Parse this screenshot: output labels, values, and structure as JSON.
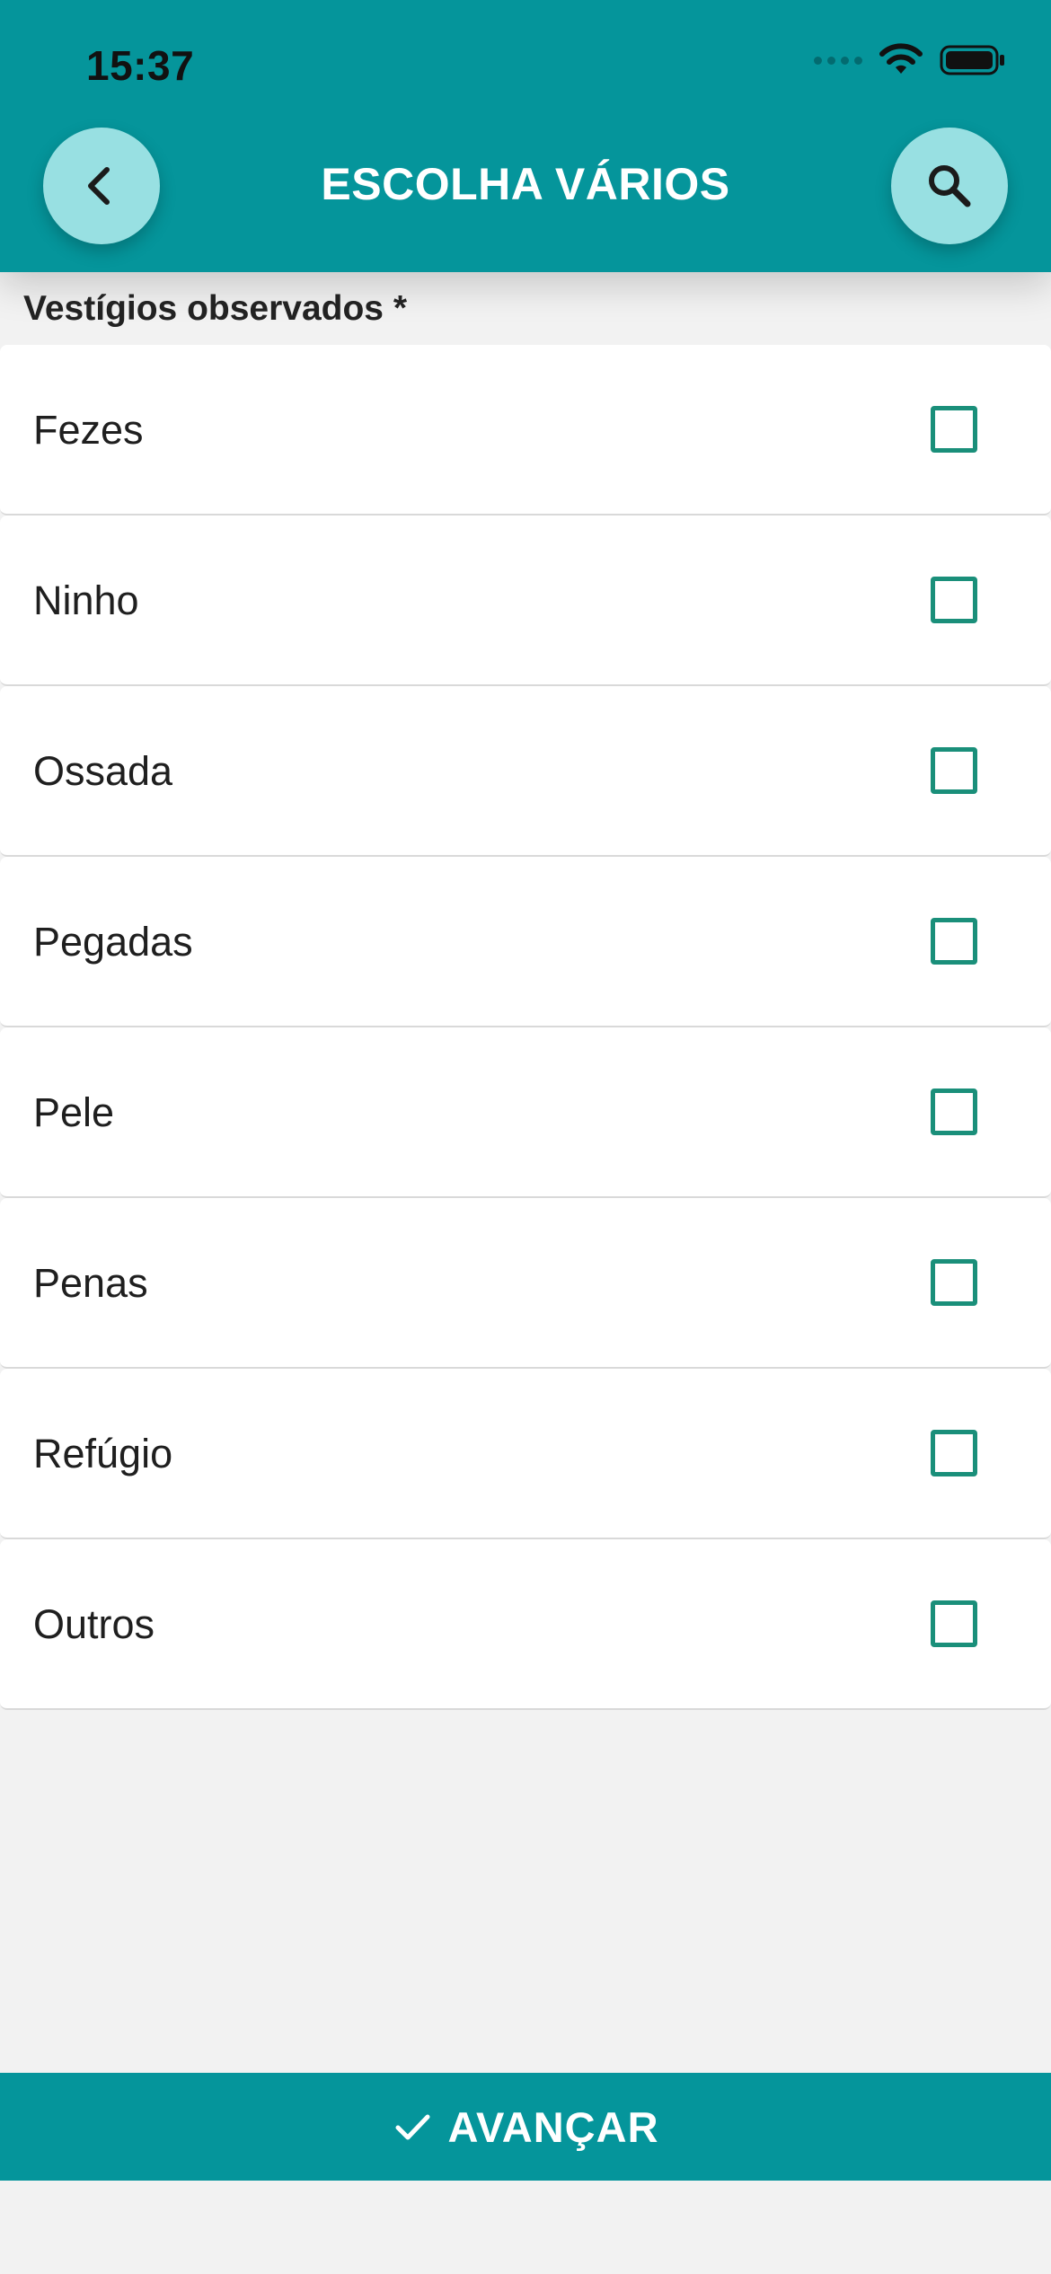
{
  "status_bar": {
    "time": "15:37",
    "icons": [
      "cellular-signal-icon",
      "wifi-icon",
      "battery-icon"
    ]
  },
  "header": {
    "title": "ESCOLHA VÁRIOS",
    "back_icon": "chevron-left-icon",
    "search_icon": "search-icon"
  },
  "section": {
    "label": "Vestígios observados *"
  },
  "options": [
    {
      "label": "Fezes",
      "checked": false
    },
    {
      "label": "Ninho",
      "checked": false
    },
    {
      "label": "Ossada",
      "checked": false
    },
    {
      "label": "Pegadas",
      "checked": false
    },
    {
      "label": "Pele",
      "checked": false
    },
    {
      "label": "Penas",
      "checked": false
    },
    {
      "label": "Refúgio",
      "checked": false
    },
    {
      "label": "Outros",
      "checked": false
    }
  ],
  "footer": {
    "button_label": "AVANÇAR",
    "button_icon": "check-icon"
  },
  "colors": {
    "primary": "#05959b",
    "button_light": "#98e0e2",
    "checkbox_border": "#1a8f7a",
    "background": "#f2f2f2"
  }
}
